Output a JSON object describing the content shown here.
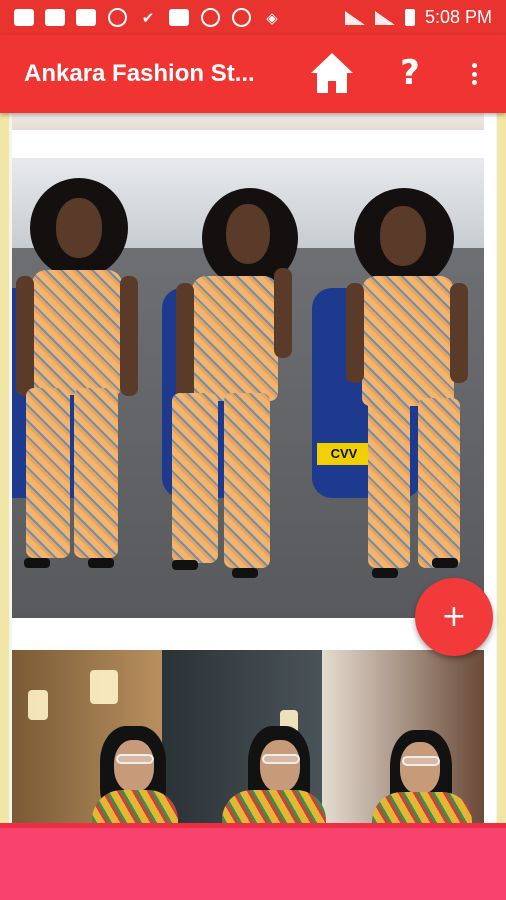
{
  "status_bar": {
    "time": "5:08 PM",
    "icons": [
      "chat-icon",
      "mail-icon",
      "mail-icon",
      "vpn-icon",
      "check-icon",
      "image-icon",
      "whatsapp-icon",
      "vpn-icon",
      "app-icon"
    ]
  },
  "app_bar": {
    "title": "Ankara Fashion St...",
    "help_symbol": "?",
    "home_icon": "home-icon",
    "menu_icon": "overflow-menu-icon"
  },
  "feed": {
    "images": [
      {
        "plate_text": "CVV"
      },
      {}
    ]
  },
  "fab": {
    "symbol": "+"
  },
  "colors": {
    "app_bar": "#f03431",
    "status_bar": "#e8332f",
    "fab": "#f23a3b",
    "bottom_bar": "#f7436e"
  }
}
